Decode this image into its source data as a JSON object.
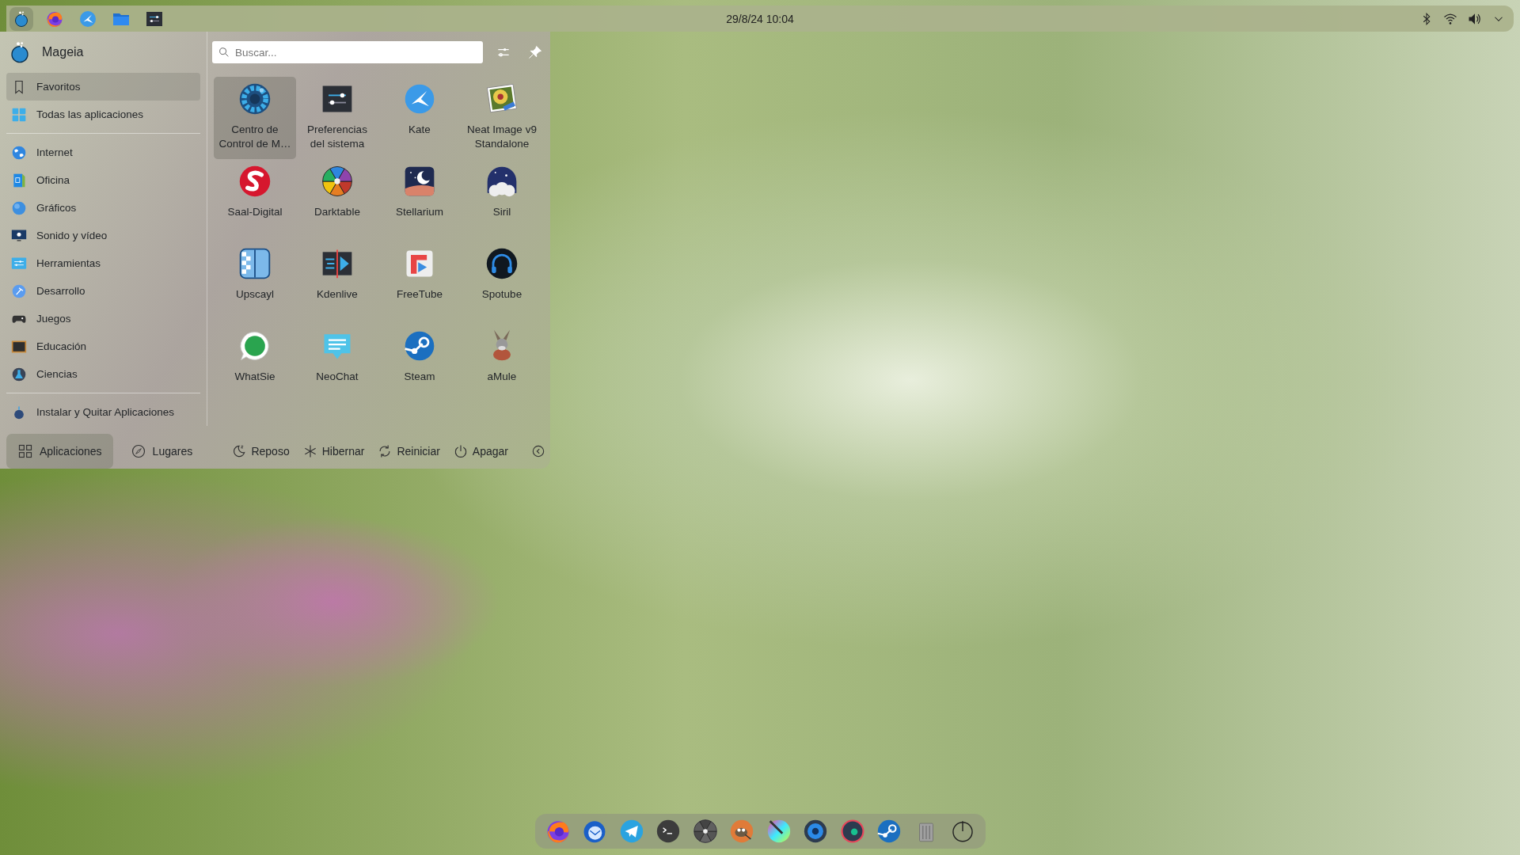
{
  "top_panel": {
    "launcher_active": true,
    "clock": "29/8/24 10:04"
  },
  "menu": {
    "user": "Mageia",
    "search": {
      "placeholder": "Buscar..."
    },
    "sidebar": {
      "groups": [
        {
          "items": [
            {
              "label": "Favoritos",
              "selected": true
            },
            {
              "label": "Todas las aplicaciones",
              "selected": false
            }
          ]
        },
        {
          "items": [
            {
              "label": "Internet",
              "selected": false
            },
            {
              "label": "Oficina",
              "selected": false
            },
            {
              "label": "Gráficos",
              "selected": false
            },
            {
              "label": "Sonido y vídeo",
              "selected": false
            },
            {
              "label": "Herramientas",
              "selected": false
            },
            {
              "label": "Desarrollo",
              "selected": false
            },
            {
              "label": "Juegos",
              "selected": false
            },
            {
              "label": "Educación",
              "selected": false
            },
            {
              "label": "Ciencias",
              "selected": false
            }
          ]
        },
        {
          "items": [
            {
              "label": "Instalar y Quitar Aplicaciones",
              "selected": false
            }
          ]
        }
      ]
    },
    "apps": [
      {
        "label": "Centro de Control de M…",
        "selected": true
      },
      {
        "label": "Preferencias del sistema",
        "selected": false
      },
      {
        "label": "Kate",
        "selected": false
      },
      {
        "label": "Neat Image v9 Standalone",
        "selected": false
      },
      {
        "label": "Saal-Digital",
        "selected": false
      },
      {
        "label": "Darktable",
        "selected": false
      },
      {
        "label": "Stellarium",
        "selected": false
      },
      {
        "label": "Siril",
        "selected": false
      },
      {
        "label": "Upscayl",
        "selected": false
      },
      {
        "label": "Kdenlive",
        "selected": false
      },
      {
        "label": "FreeTube",
        "selected": false
      },
      {
        "label": "Spotube",
        "selected": false
      },
      {
        "label": "WhatSie",
        "selected": false
      },
      {
        "label": "NeoChat",
        "selected": false
      },
      {
        "label": "Steam",
        "selected": false
      },
      {
        "label": "aMule",
        "selected": false
      }
    ],
    "tabs": [
      {
        "label": "Aplicaciones",
        "selected": true
      },
      {
        "label": "Lugares",
        "selected": false
      }
    ],
    "power_actions": [
      "Reposo",
      "Hibernar",
      "Reiniciar",
      "Apagar"
    ]
  }
}
